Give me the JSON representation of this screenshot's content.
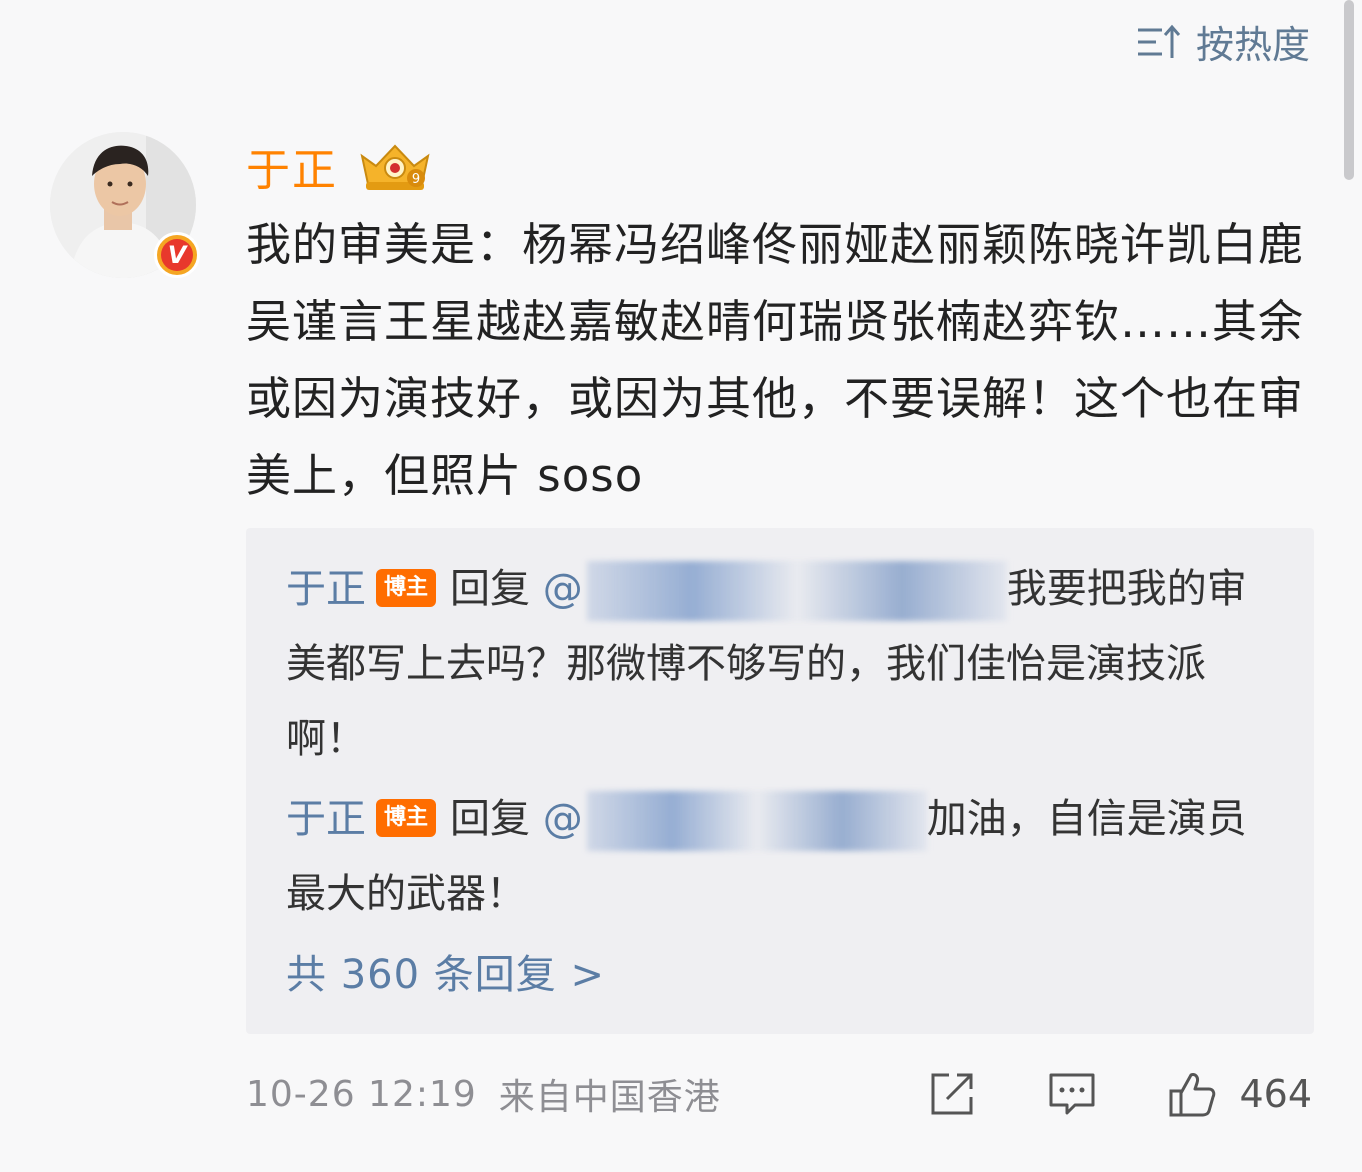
{
  "sort": {
    "label": "按热度",
    "icon": "sort-icon"
  },
  "comment": {
    "username": "于正",
    "text": "我的审美是：杨幂冯绍峰佟丽娅赵丽颖陈晓许凯白鹿吴谨言王星越赵嘉敏赵晴何瑞贤张楠赵弈钦……其余或因为演技好，或因为其他，不要误解！这个也在审美上，但照片 soso"
  },
  "replies": [
    {
      "username": "于正",
      "tag": "博主",
      "reply_word": "回复",
      "mention_prefix": "@",
      "text": "我要把我的审美都写上去吗？那微博不够写的，我们佳怡是演技派啊！"
    },
    {
      "username": "于正",
      "tag": "博主",
      "reply_word": "回复",
      "mention_prefix": "@",
      "text": "加油，自信是演员最大的武器！"
    }
  ],
  "more_replies": "共 360 条回复 >",
  "footer": {
    "timestamp": "10-26 12:19",
    "source": "来自中国香港",
    "like_count": "464"
  },
  "colors": {
    "username": "#ff8200",
    "link": "#5b7da5",
    "blogger_tag": "#ff6d00",
    "reply_bg": "#efeff2"
  }
}
